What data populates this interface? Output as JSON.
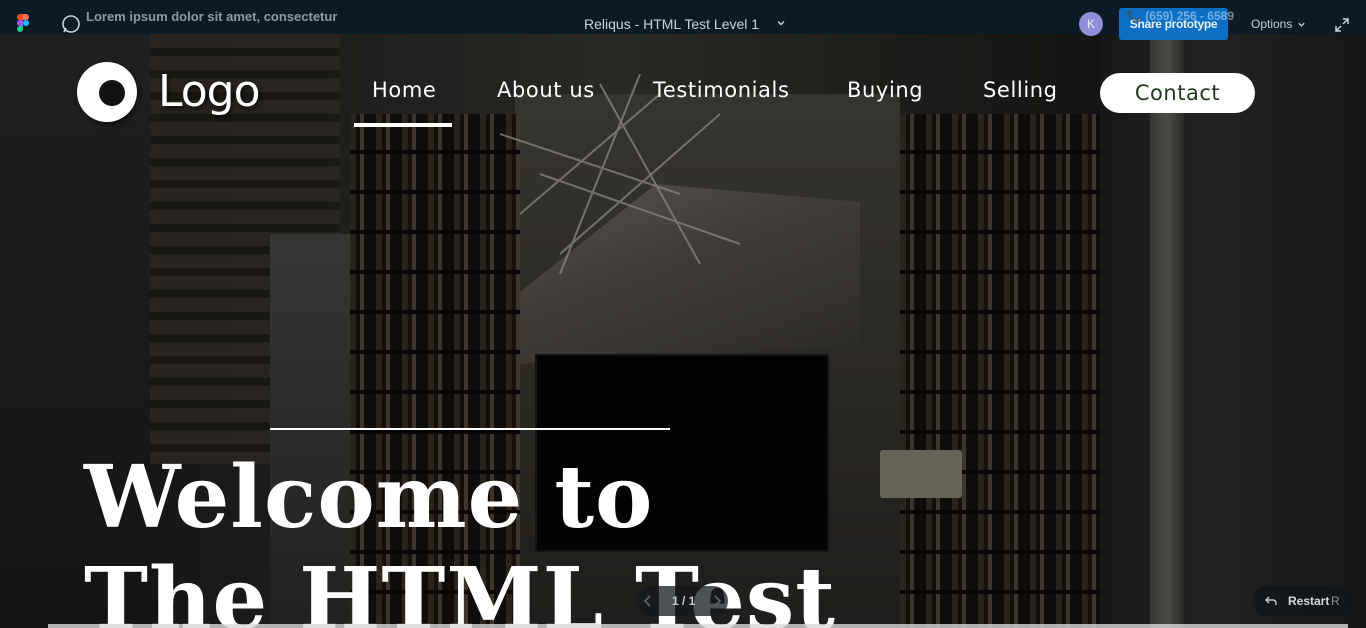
{
  "figma_bar": {
    "lorem": "Lorem ipsum dolor sit amet, consectetur",
    "title": "Reliqus - HTML Test Level 1",
    "avatar_initial": "K",
    "share_label": "Share prototype",
    "phone": "📞 (659) 256 - 6589",
    "options_label": "Options"
  },
  "site": {
    "logo_text": "Logo",
    "nav": {
      "home": "Home",
      "about": "About us",
      "testimonials": "Testimonials",
      "buying": "Buying",
      "selling": "Selling",
      "contact": "Contact"
    },
    "active_nav": "Home"
  },
  "hero": {
    "line1": "Welcome to",
    "line2": "The HTML Test"
  },
  "prototype_controls": {
    "page_count": "1 / 1",
    "restart_label": "Restart",
    "restart_key": "R"
  }
}
